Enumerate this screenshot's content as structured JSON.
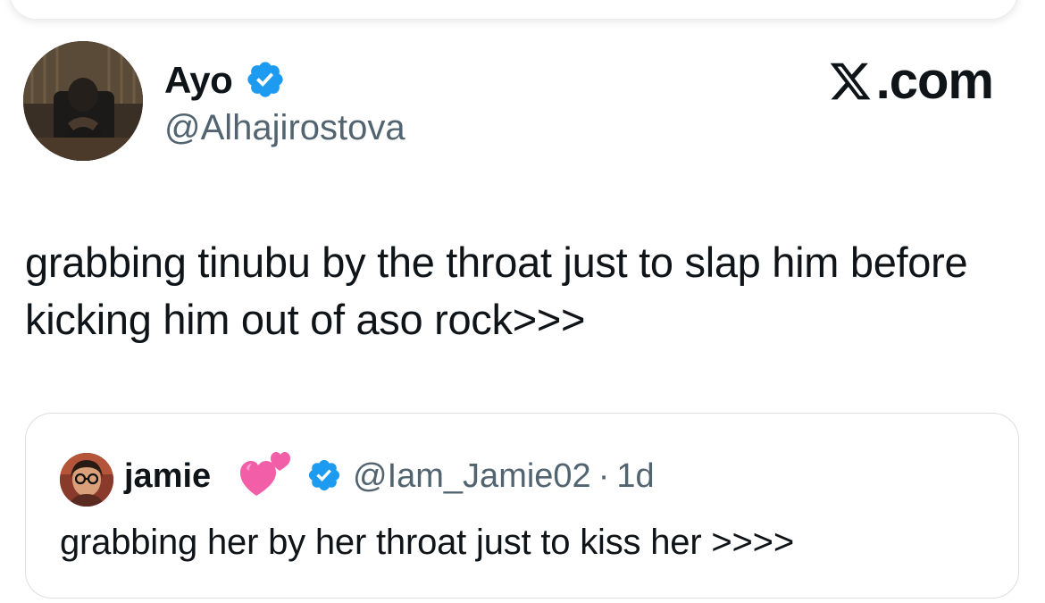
{
  "author": {
    "display_name": "Ayo",
    "handle": "@Alhajirostova",
    "verified": true
  },
  "brand": {
    "label": ".com",
    "icon": "x-logo-icon"
  },
  "tweet": {
    "text": "grabbing tinubu by the throat just to slap him before kicking him out of aso rock>>>"
  },
  "quoted_tweet": {
    "display_name": "jamie",
    "name_emoji": "heart-emoji-icon",
    "handle": "@Iam_Jamie02",
    "separator": "·",
    "time": "1d",
    "verified": true,
    "text": "grabbing her by her throat just to kiss her >>>>"
  },
  "colors": {
    "verified_blue": "#1d9bf0",
    "secondary_text": "#536471",
    "primary_text": "#0f1419",
    "heart_pink": "#f25ea8"
  }
}
